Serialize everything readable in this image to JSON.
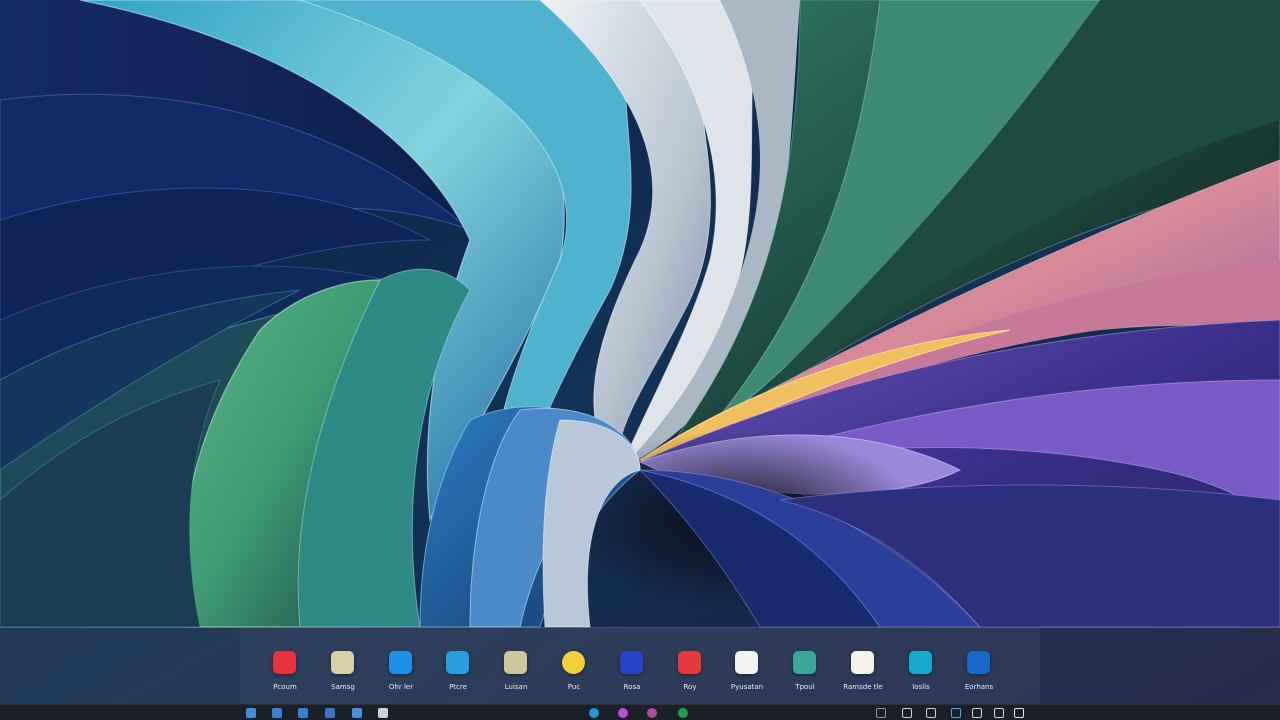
{
  "dock": {
    "apps": [
      {
        "label": "Pcoum",
        "icon": "red-app-icon",
        "color": "#e8323c",
        "glyph": ""
      },
      {
        "label": "Samsg",
        "icon": "notes-app-icon",
        "color": "#d8d0a8",
        "glyph": ""
      },
      {
        "label": "Ohr ler",
        "icon": "files-app-icon",
        "color": "#1f8ee6",
        "glyph": ""
      },
      {
        "label": "Ptcre",
        "icon": "store-app-icon",
        "color": "#2a9ee0",
        "glyph": ""
      },
      {
        "label": "Luisan",
        "icon": "gallery-app-icon",
        "color": "#cfc79b",
        "glyph": ""
      },
      {
        "label": "Puc",
        "icon": "sun-app-icon",
        "color": "#f2d03a",
        "glyph": ""
      },
      {
        "label": "Rosa",
        "icon": "messenger-app-icon",
        "color": "#2744c8",
        "glyph": ""
      },
      {
        "label": "Roy",
        "icon": "media-app-icon",
        "color": "#e33b3b",
        "glyph": ""
      },
      {
        "label": "Pyusatan",
        "icon": "paint-app-icon",
        "color": "#f2f2f2",
        "glyph": ""
      },
      {
        "label": "Tpoul",
        "icon": "maps-app-icon",
        "color": "#3aa899",
        "glyph": ""
      },
      {
        "label": "Ramsde tle",
        "icon": "photos-app-icon",
        "color": "#f4f2ea",
        "glyph": ""
      },
      {
        "label": "Ioslis",
        "icon": "chat-app-icon",
        "color": "#19a9cf",
        "glyph": ""
      },
      {
        "label": "Eorhans",
        "icon": "mail-app-icon",
        "color": "#1668c9",
        "glyph": ""
      }
    ]
  },
  "taskbar": {
    "left": [
      {
        "icon": "start-icon",
        "color": "#3b8fe0"
      },
      {
        "icon": "widgets-icon",
        "color": "#3a7fd4"
      },
      {
        "icon": "edge-icon",
        "color": "#2f86d6"
      },
      {
        "icon": "store-icon",
        "color": "#3a76c8"
      },
      {
        "icon": "task-view-icon",
        "color": "#4a90e2"
      },
      {
        "icon": "mail-icon",
        "color": "#c9d2de"
      }
    ],
    "center": [
      {
        "icon": "browser-icon",
        "color": "#1f9ad6"
      },
      {
        "icon": "music-icon",
        "color": "#c44ad8"
      },
      {
        "icon": "camera-icon",
        "color": "#b04aa0"
      },
      {
        "icon": "spotify-icon",
        "color": "#1aa34a"
      }
    ],
    "right": [
      {
        "icon": "keyboard-icon",
        "color": "#8a96a6"
      },
      {
        "icon": "game-icon",
        "color": "#c9d2de"
      },
      {
        "icon": "inbox-icon",
        "color": "#c9d2de"
      },
      {
        "icon": "network-icon",
        "color": "#4fa3e0"
      },
      {
        "icon": "volume-icon",
        "color": "#c9d2de"
      },
      {
        "icon": "battery-icon",
        "color": "#c9d2de"
      },
      {
        "icon": "notifications-icon",
        "color": "#dfe6ef"
      }
    ]
  }
}
